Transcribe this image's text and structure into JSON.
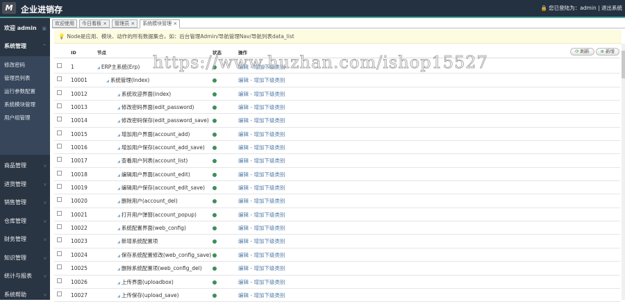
{
  "header": {
    "logo": "M",
    "title": "企业进销存",
    "user_info": "您已登陆为：admin | 退出系统"
  },
  "sidebar": {
    "welcome": "欢迎 admin",
    "active_group": "系统管理",
    "sub_items": [
      "修改密码",
      "管理员列表",
      "运行参数配置",
      "系统模块管理",
      "用户组管理"
    ],
    "groups": [
      "商品管理",
      "进货管理",
      "销售管理",
      "仓库管理",
      "财务管理",
      "知识管理",
      "统计与报表",
      "系统帮助"
    ]
  },
  "tabs": [
    "欢迎使用",
    "今日看板 ×",
    "管理员 ×",
    "系统模块管理 ×"
  ],
  "alert": "Node是应用、模块、动作的所有数据集合，如：后台管理Admin/导航管理Nav/导航列表data_list",
  "buttons": {
    "refresh": "刷新",
    "add": "新增"
  },
  "columns": {
    "id": "ID",
    "node": "节点",
    "status": "状态",
    "ops": "操作"
  },
  "actions": {
    "edit": "编辑 -",
    "add_child": "增加下级类别"
  },
  "rows": [
    {
      "id": "1",
      "node": "ERP主系统(Erp)",
      "level": 0
    },
    {
      "id": "10001",
      "node": "系统管理(Index)",
      "level": 1
    },
    {
      "id": "10012",
      "node": "系统欢迎界面(index)",
      "level": 2
    },
    {
      "id": "10013",
      "node": "修改密码界面(edit_password)",
      "level": 2
    },
    {
      "id": "10014",
      "node": "修改密码保存(edit_password_save)",
      "level": 2
    },
    {
      "id": "10015",
      "node": "增加用户界面(account_add)",
      "level": 2
    },
    {
      "id": "10016",
      "node": "增加用户保存(account_add_save)",
      "level": 2
    },
    {
      "id": "10017",
      "node": "查看用户列表(account_list)",
      "level": 2
    },
    {
      "id": "10018",
      "node": "编辑用户界面(account_edit)",
      "level": 2
    },
    {
      "id": "10019",
      "node": "编辑用户保存(account_edit_save)",
      "level": 2
    },
    {
      "id": "10020",
      "node": "删除用户(account_del)",
      "level": 2
    },
    {
      "id": "10021",
      "node": "打开用户弹窗(account_popup)",
      "level": 2
    },
    {
      "id": "10022",
      "node": "系统配置界面(web_config)",
      "level": 2
    },
    {
      "id": "10023",
      "node": "新增系统配置项",
      "level": 2
    },
    {
      "id": "10024",
      "node": "保存系统配置修改(web_config_save)",
      "level": 2
    },
    {
      "id": "10025",
      "node": "删除系统配置项(web_config_del)",
      "level": 2
    },
    {
      "id": "10026",
      "node": "上传界面(uploadbox)",
      "level": 2
    },
    {
      "id": "10027",
      "node": "上传保存(upload_save)",
      "level": 2
    }
  ],
  "watermark": "https://www.huzhan.com/ishop15527",
  "colors": {
    "header": "#243140",
    "sidebar": "#2a3543",
    "status_on": "#3e8e5a",
    "link": "#4e79a8"
  }
}
